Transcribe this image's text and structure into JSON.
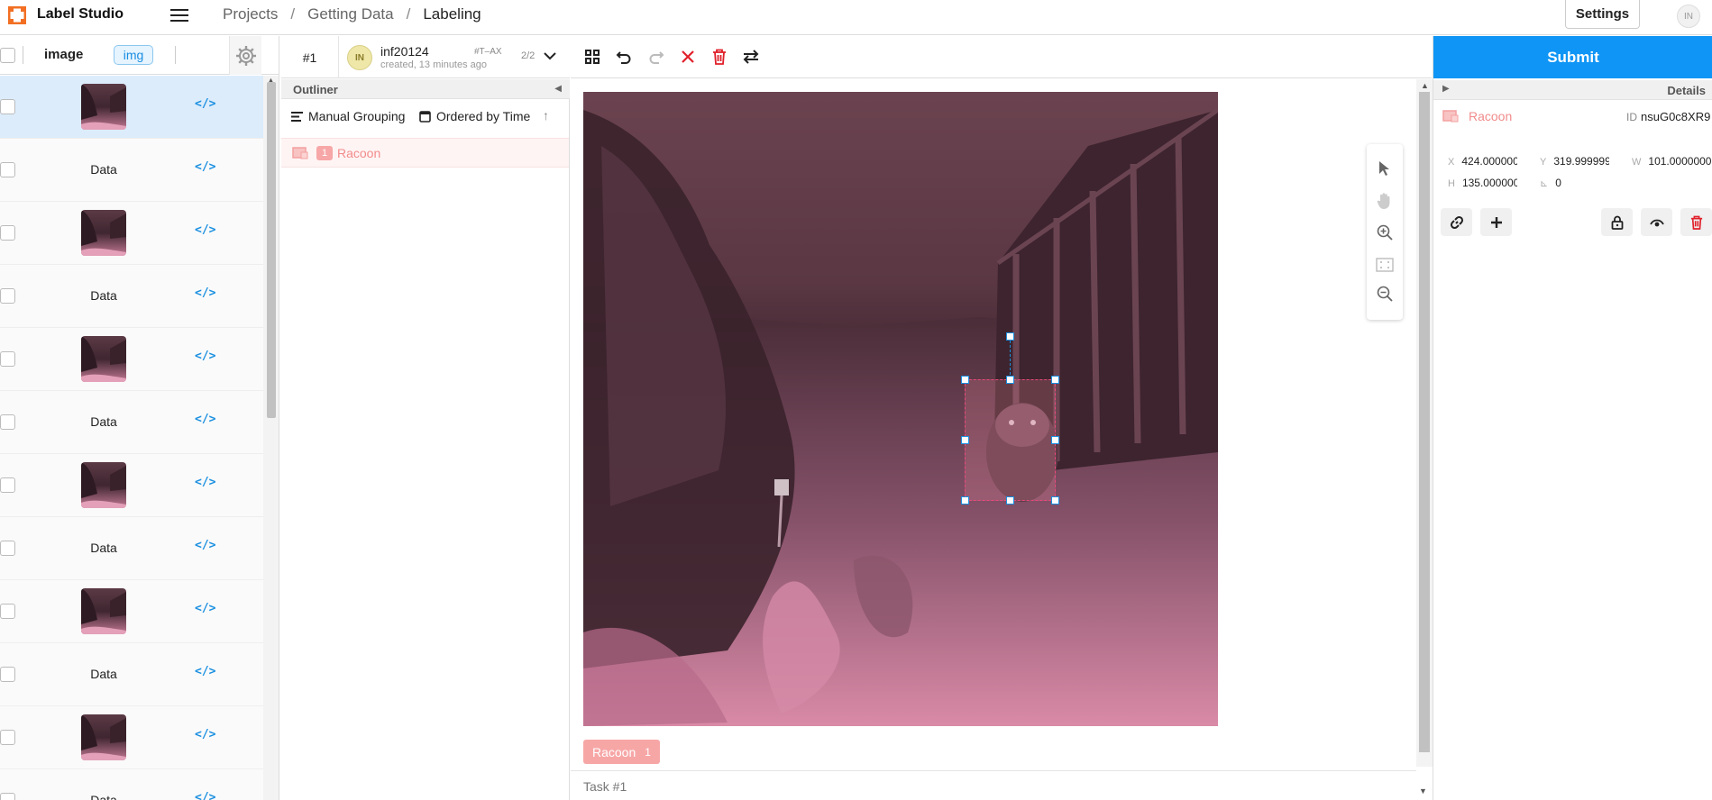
{
  "app": {
    "title": "Label Studio"
  },
  "breadcrumb": {
    "items": [
      "Projects",
      "Getting Data",
      "Labeling"
    ],
    "separator": "/"
  },
  "header": {
    "settings_label": "Settings",
    "user_initials": "IN"
  },
  "datalist": {
    "col_image": "image",
    "col_badge": "img",
    "code_icon": "</>",
    "rows": [
      {
        "type": "image",
        "selected": true
      },
      {
        "type": "data",
        "text": "Data"
      },
      {
        "type": "image"
      },
      {
        "type": "data",
        "text": "Data"
      },
      {
        "type": "image"
      },
      {
        "type": "data",
        "text": "Data"
      },
      {
        "type": "image"
      },
      {
        "type": "data",
        "text": "Data"
      },
      {
        "type": "image"
      },
      {
        "type": "data",
        "text": "Data"
      },
      {
        "type": "image"
      },
      {
        "type": "data",
        "text": "Data"
      }
    ]
  },
  "annotation": {
    "task_number": "#1",
    "user_initials": "IN",
    "user": "inf20124",
    "created": "created, 13 minutes ago",
    "id": "#T–AX",
    "count": "2/2"
  },
  "outliner": {
    "title": "Outliner",
    "grouping": "Manual Grouping",
    "order": "Ordered by Time",
    "regions": [
      {
        "index": "1",
        "label": "Racoon"
      }
    ]
  },
  "toolbar": {
    "icons": [
      "grid-icon",
      "undo-icon",
      "redo-icon",
      "reset-icon",
      "delete-icon",
      "swap-icon"
    ]
  },
  "canvas": {
    "label_chip": {
      "label": "Racoon",
      "count": "1"
    },
    "tools": [
      "pointer-icon",
      "hand-icon",
      "zoom-in-icon",
      "zoom-to-fit-icon",
      "zoom-out-icon"
    ]
  },
  "footer": {
    "task_label": "Task #1"
  },
  "details": {
    "submit_label": "Submit",
    "title": "Details",
    "region_label": "Racoon",
    "id_label": "ID",
    "id_value": "nsuG0c8XR9",
    "x_label": "X",
    "x": "424.000000000",
    "y_label": "Y",
    "y": "319.999999999",
    "w_label": "W",
    "w": "101.000000000",
    "h_label": "H",
    "h": "135.000000000",
    "angle_label": "⊾",
    "angle": "0"
  },
  "colors": {
    "accent": "#0f95f5",
    "region": "#f7a6a6",
    "danger": "#e0202a"
  }
}
